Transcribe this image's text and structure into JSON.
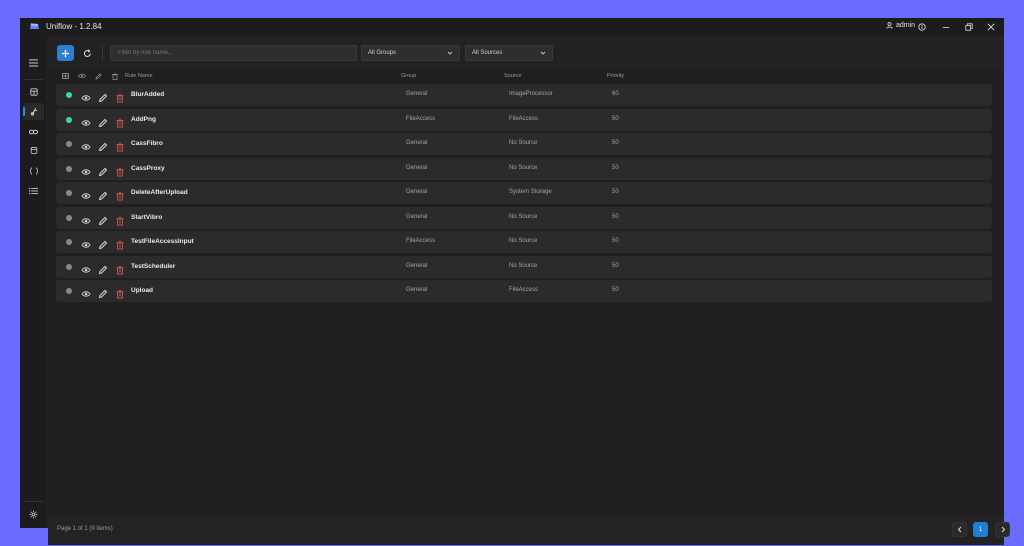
{
  "app": {
    "title": "Uniflow - 1.2.84"
  },
  "titlebar": {
    "user_label": "admin",
    "user_icon": "user-icon",
    "info_icon": "info-icon",
    "minimize_icon": "minimize-icon",
    "restore_icon": "restore-icon",
    "close_icon": "close-icon"
  },
  "sidebar": {
    "items": [
      {
        "name": "menu",
        "icon": "hamburger-icon"
      },
      {
        "name": "dashboard",
        "icon": "dashboard-icon"
      },
      {
        "name": "rules",
        "icon": "rules-icon",
        "active": true
      },
      {
        "name": "connections",
        "icon": "link-icon"
      },
      {
        "name": "storage",
        "icon": "database-icon"
      },
      {
        "name": "scripts",
        "icon": "braces-icon"
      },
      {
        "name": "logs",
        "icon": "list-icon"
      },
      {
        "name": "settings",
        "icon": "gear-icon"
      }
    ]
  },
  "toolbar": {
    "add_icon": "plus-icon",
    "refresh_icon": "refresh-icon",
    "filter_placeholder": "Filter by rule name...",
    "group_select": "All Groups",
    "source_select": "All Sources"
  },
  "table": {
    "headers": {
      "rule_name": "Rule Name",
      "group": "Group",
      "source": "Source",
      "priority": "Priority"
    },
    "header_icons": [
      "grid-icon",
      "eye-icon",
      "pencil-icon",
      "trash-icon"
    ],
    "rows": [
      {
        "status": "active",
        "name": "BlurAdded",
        "group": "General",
        "source": "ImageProcessor",
        "priority": "60"
      },
      {
        "status": "active",
        "name": "AddPng",
        "group": "FileAccess",
        "source": "FileAccess",
        "priority": "50"
      },
      {
        "status": "inactive",
        "name": "CassFibro",
        "group": "General",
        "source": "No Source",
        "priority": "50"
      },
      {
        "status": "inactive",
        "name": "CassProxy",
        "group": "General",
        "source": "No Source",
        "priority": "50"
      },
      {
        "status": "inactive",
        "name": "DeleteAfterUpload",
        "group": "General",
        "source": "System Storage",
        "priority": "50"
      },
      {
        "status": "inactive",
        "name": "StartVibro",
        "group": "General",
        "source": "No Source",
        "priority": "50"
      },
      {
        "status": "inactive",
        "name": "TestFileAccessInput",
        "group": "FileAccess",
        "source": "No Source",
        "priority": "50"
      },
      {
        "status": "inactive",
        "name": "TestScheduler",
        "group": "General",
        "source": "No Source",
        "priority": "50"
      },
      {
        "status": "inactive",
        "name": "Upload",
        "group": "General",
        "source": "FileAccess",
        "priority": "50"
      }
    ]
  },
  "footer": {
    "page_info": "Page 1 of 1 (9 items)",
    "current_page": "1"
  },
  "colors": {
    "accent": "#2d7fd1",
    "active_dot": "#3dd6a8",
    "inactive_dot": "#8a8a8a",
    "delete": "#c0504d"
  }
}
